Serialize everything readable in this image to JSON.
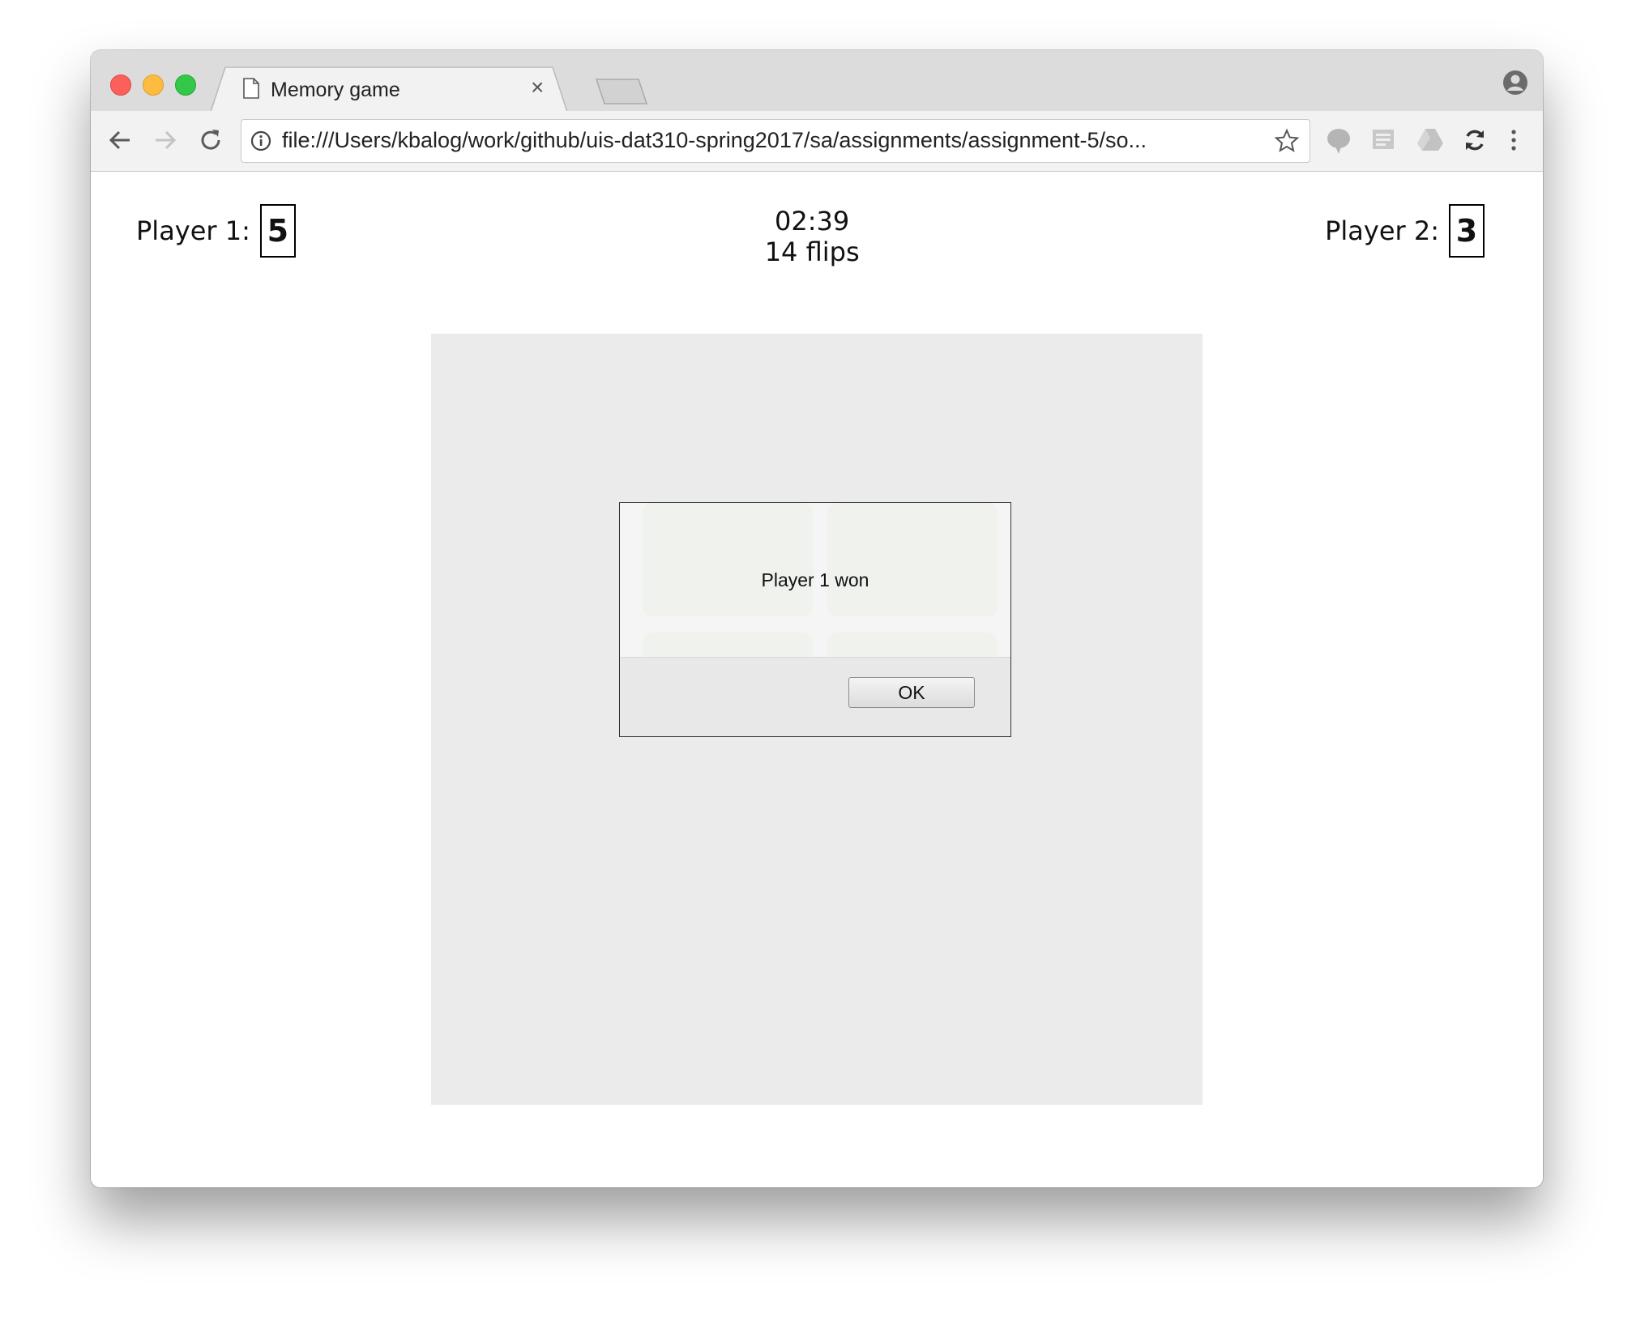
{
  "browser": {
    "tab_title": "Memory game",
    "tab_close": "×",
    "url": "file:///Users/kbalog/work/github/uis-dat310-spring2017/sa/assignments/assignment-5/so..."
  },
  "game": {
    "player1_label": "Player 1:",
    "player1_score": "5",
    "player2_label": "Player 2:",
    "player2_score": "3",
    "timer": "02:39",
    "flips": "14 flips"
  },
  "dialog": {
    "message": "Player 1 won",
    "ok_label": "OK"
  }
}
